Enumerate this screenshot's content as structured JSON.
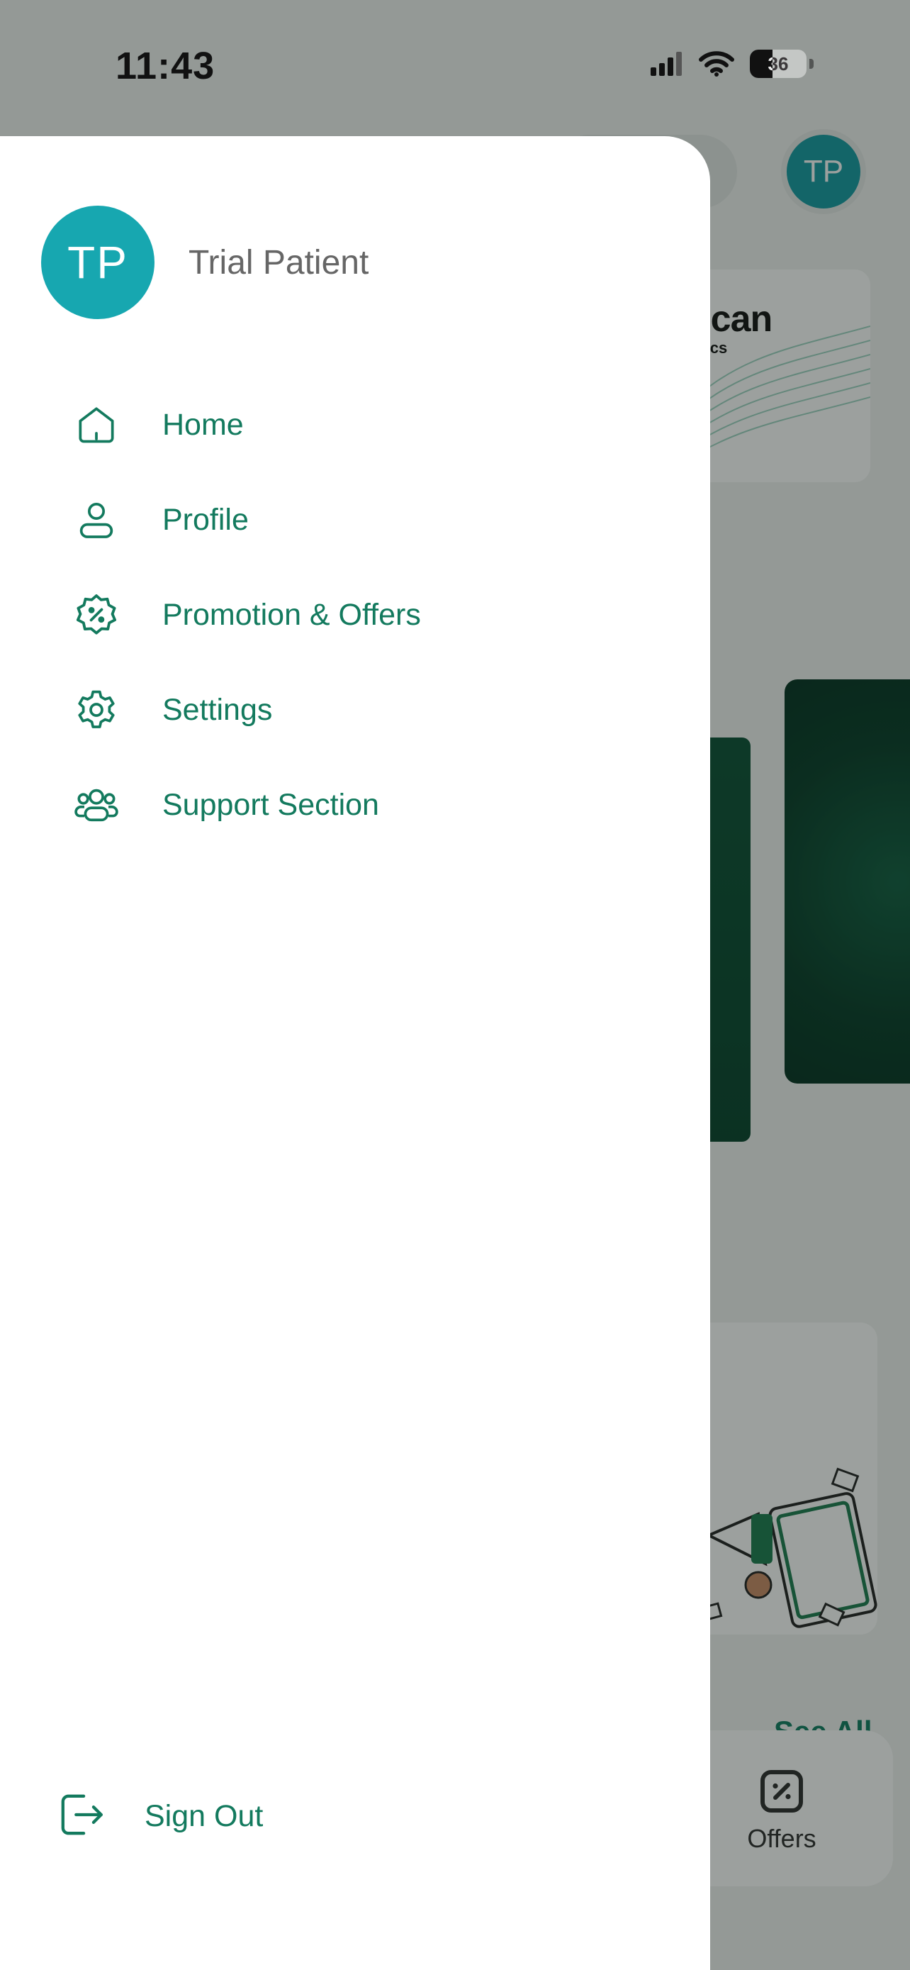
{
  "status_bar": {
    "time": "11:43",
    "battery": "36"
  },
  "background": {
    "header_avatar": "TP",
    "brand_text_1": "rican",
    "brand_text_2": "linics",
    "see_all": "See All",
    "nav_offers_label": "Offers"
  },
  "drawer": {
    "user": {
      "initials": "TP",
      "name": "Trial Patient"
    },
    "menu": [
      {
        "label": "Home",
        "icon": "home-icon"
      },
      {
        "label": "Profile",
        "icon": "user-icon"
      },
      {
        "label": "Promotion & Offers",
        "icon": "discount-badge-icon"
      },
      {
        "label": "Settings",
        "icon": "gear-icon"
      },
      {
        "label": "Support Section",
        "icon": "users-group-icon"
      }
    ],
    "sign_out": {
      "label": "Sign Out",
      "icon": "logout-icon"
    }
  },
  "colors": {
    "accent": "#137a5e",
    "avatar": "#17a7b0",
    "dark_green": "#063a26"
  }
}
